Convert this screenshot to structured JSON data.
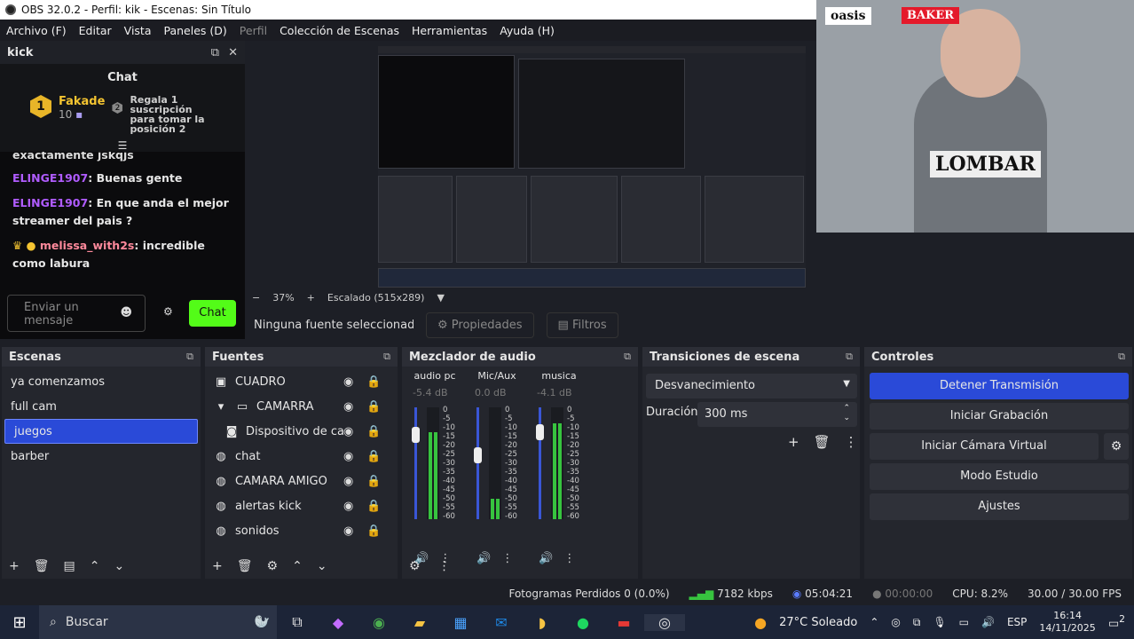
{
  "window": {
    "title": "OBS 32.0.2 - Perfil: kik - Escenas: Sin Título"
  },
  "menu": [
    "Archivo (F)",
    "Editar",
    "Vista",
    "Paneles (D)",
    "Perfil",
    "Colección de Escenas",
    "Herramientas",
    "Ayuda (H)"
  ],
  "chat_dock": {
    "title": "kick",
    "heading": "Chat",
    "gift": {
      "user": "Fakade",
      "rank": "1",
      "count": "10",
      "rank2": "2",
      "text": "Regala 1 suscripción para tomar la posición 2"
    },
    "cut_message": "exactamente jskqjs",
    "messages": [
      {
        "user": "ELINGE1907",
        "text": "Buenas gente"
      },
      {
        "user": "ELINGE1907",
        "text": "En que anda el mejor streamer del pais ?"
      },
      {
        "user": "melissa_with2s",
        "text": "incredible como labura"
      }
    ],
    "input_placeholder": "Enviar un mensaje",
    "send_label": "Chat"
  },
  "preview": {
    "zoom": "37%",
    "scale_label": "Escalado (515x289)",
    "cam_logos": [
      "oasis",
      "BAKER",
      "LOMBAR"
    ]
  },
  "source_bar": {
    "selected": "Ninguna fuente seleccionad",
    "properties": "Propiedades",
    "filters": "Filtros"
  },
  "scenes": {
    "title": "Escenas",
    "items": [
      "ya comenzamos",
      "full cam",
      "juegos",
      "barber"
    ],
    "selected": "juegos"
  },
  "sources": {
    "title": "Fuentes",
    "items": [
      "CUADRO",
      "CAMARRA",
      "Dispositivo de captu",
      "chat",
      "CAMARA AMIGO",
      "alertas kick",
      "sonidos"
    ]
  },
  "mixer": {
    "title": "Mezclador de audio",
    "channels": [
      {
        "name": "audio pc",
        "db": "-5.4 dB",
        "level": 0.78
      },
      {
        "name": "Mic/Aux",
        "db": "0.0 dB",
        "level": 0.18
      },
      {
        "name": "musica",
        "db": "-4.1 dB",
        "level": 0.86
      }
    ],
    "scale": [
      "0",
      "-5",
      "-10",
      "-15",
      "-20",
      "-25",
      "-30",
      "-35",
      "-40",
      "-45",
      "-50",
      "-55",
      "-60"
    ]
  },
  "transitions": {
    "title": "Transiciones de escena",
    "selected": "Desvanecimiento",
    "duration_label": "Duración",
    "duration": "300 ms"
  },
  "controls": {
    "title": "Controles",
    "buttons": [
      "Detener Transmisión",
      "Iniciar Grabación",
      "Iniciar Cámara Virtual",
      "Modo Estudio",
      "Ajustes"
    ]
  },
  "status": {
    "dropped": "Fotogramas Perdidos 0 (0.0%)",
    "kbps": "7182 kbps",
    "live_time": "05:04:21",
    "rec_time": "00:00:00",
    "cpu": "CPU: 8.2%",
    "fps": "30.00 / 30.00 FPS"
  },
  "taskbar": {
    "search": "Buscar",
    "weather": "27°C Soleado",
    "lang": "ESP",
    "time": "16:14",
    "date": "14/11/2025",
    "notif": "2"
  }
}
